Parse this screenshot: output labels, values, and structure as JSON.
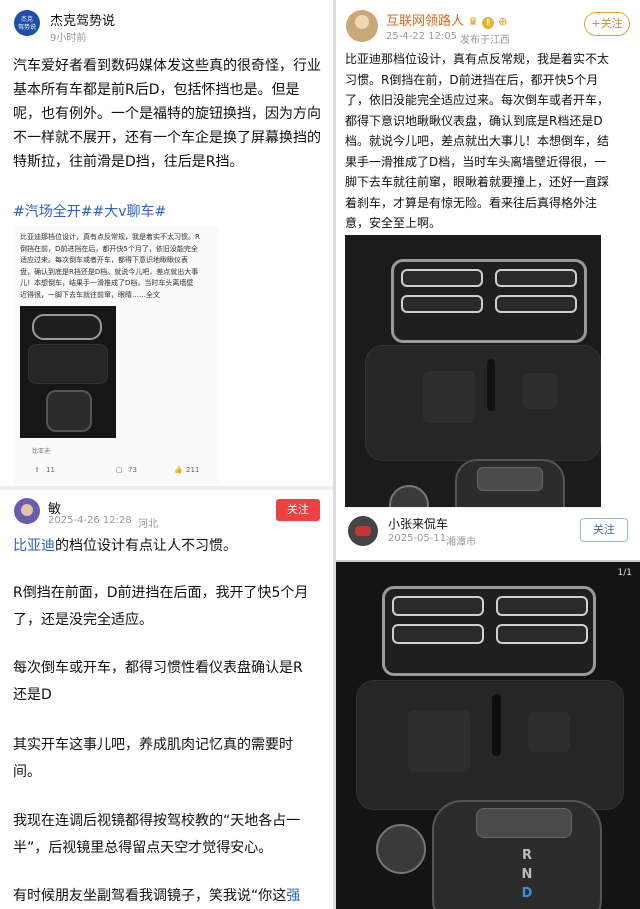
{
  "left": {
    "post1": {
      "author": "杰克驾势说",
      "avatar_text": "杰克\n驾势说",
      "time": "9小时前",
      "body_lines": [
        "汽车爱好者看到数码媒体发这些真的很奇怪，行业",
        "基本所有车都是前R后D，包括怀挡也是。但是",
        "呢，也有例外。一个是福特的旋钮换挡，因为方向",
        "不一样就不展开，还有一个车企是换了屏幕换挡的",
        "特斯拉，往前滑是D挡，往后是R挡。"
      ],
      "hashtags": "#汽场全开##大v聊车#",
      "quote_lines": [
        "比亚迪那档位设计，真有点反常规，我是着实不太习惯。R",
        "倒挡在前，D前进挡在后，都开快5个月了，依旧没能完全",
        "适应过来。每次倒车或者开车，都得下意识地瞅瞅仪表",
        "盘，确认到底是R挡还是D档。就说今儿吧，差点就出大事",
        "儿！本想倒车，结果手一滑推成了D档，当时车头离墙壁",
        "近得很，一脚下去车就往前窜，眼睛……全文"
      ],
      "quote_source": "比亚迪",
      "stats": [
        "11",
        "73",
        "211"
      ]
    },
    "post2": {
      "author": "敏",
      "time": "2025-4-26 12:28",
      "location": "河北",
      "follow_label": "关注",
      "paragraphs": [
        [
          "比亚迪",
          "的档位设计有点让人不习惯。"
        ],
        [
          "R倒挡在前面，D前进挡在后面，我开了快5个月",
          "了，还是没完全适应。"
        ],
        [
          "每次倒车或开车，都得习惯性看仪表盘确认是R",
          "还是D"
        ],
        [
          "其实开车这事儿吧，养成肌肉记忆真的需要时",
          "间。"
        ],
        [
          "我现在连调后视镜都得按驾校教的“天地各占一",
          "半”，后视镜里总得留点天空才觉得安心。"
        ],
        [
          "有时候朋友坐副驾看我调镜子，笑我说“你这",
          "强"
        ]
      ]
    }
  },
  "right": {
    "post1": {
      "author": "互联网领路人",
      "badge": "Ⅱ",
      "time": "25-4-22 12:05",
      "source": "发布于",
      "location": "江西",
      "follow_label": "+关注",
      "body_lines": [
        "比亚迪那档位设计，真有点反常规，我是着实不太",
        "习惯。R倒挡在前，D前进挡在后，都开快5个月",
        "了，依旧没能完全适应过来。每次倒车或者开车，",
        "都得下意识地瞅瞅仪表盘，确认到底是R档还是D",
        "档。就说今儿吧，差点就出大事儿！本想倒车，结",
        "果手一滑推成了D档，当时车头离墙壁近得很，一",
        "脚下去车就往前窜，眼瞅着就要撞上，还好一直踩",
        "着刹车，才算是有惊无险。看来往后真得格外注",
        "意，安全至上啊。"
      ]
    },
    "post2": {
      "author": "小张来侃车",
      "time": "2025-05-11",
      "location": "湘潭市",
      "follow_label": "关注"
    },
    "image_counter": "1/1",
    "gear_letters": [
      "R",
      "N",
      "D"
    ]
  },
  "colors": {
    "red_button": "#f04142",
    "link_blue": "#2b63c6",
    "hashtag_blue": "#2b63c6"
  }
}
